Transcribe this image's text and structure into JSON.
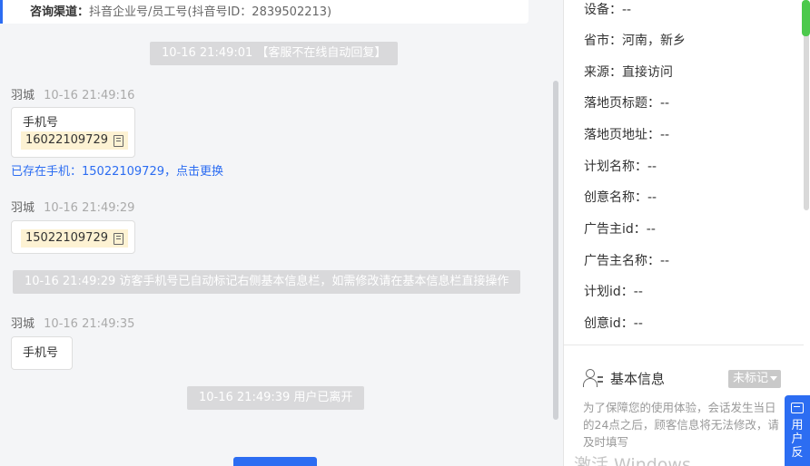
{
  "top_card": {
    "label": "咨询渠道：",
    "value": "抖音企业号/员工号(抖音号ID：2839502213)"
  },
  "messages": {
    "sys1": "10-16 21:49:01 【客服不在线自动回复】",
    "msg1": {
      "name": "羽城",
      "time": "10-16 21:49:16",
      "label": "手机号",
      "phone": "16022109729"
    },
    "exist_link": "已存在手机：15022109729，点击更换",
    "msg2": {
      "name": "羽城",
      "time": "10-16 21:49:29",
      "phone": "15022109729"
    },
    "sys2": "10-16 21:49:29 访客手机号已自动标记右侧基本信息栏，如需修改请在基本信息栏直接操作",
    "msg3": {
      "name": "羽城",
      "time": "10-16 21:49:35",
      "label": "手机号"
    },
    "sys3": "10-16 21:49:39 用户已离开"
  },
  "info": {
    "device": "设备：--",
    "region": "省市：河南，新乡",
    "source": "来源：直接访问",
    "landing_title": "落地页标题：--",
    "landing_url": "落地页地址：--",
    "plan_name": "计划名称：--",
    "creative_name": "创意名称：--",
    "advertiser_id": "广告主id：--",
    "advertiser_name": "广告主名称：--",
    "plan_id": "计划id：--",
    "creative_id": "创意id：--"
  },
  "basic_info": {
    "title": "基本信息",
    "tag": "未标记",
    "notice": "为了保障您的使用体验，会话发生当日的24点之后，顾客信息将无法修改，请及时填写"
  },
  "feedback": {
    "label": "用户反"
  },
  "watermark": "激活 Windows",
  "colors": {
    "accent": "#2c6df2",
    "phone_highlight": "#fdf2d3",
    "system_msg": "#d9d9db",
    "status_green": "#4cc94c"
  },
  "icons": [
    "copy-icon",
    "user-icon",
    "caret-down-icon",
    "feedback-icon"
  ]
}
